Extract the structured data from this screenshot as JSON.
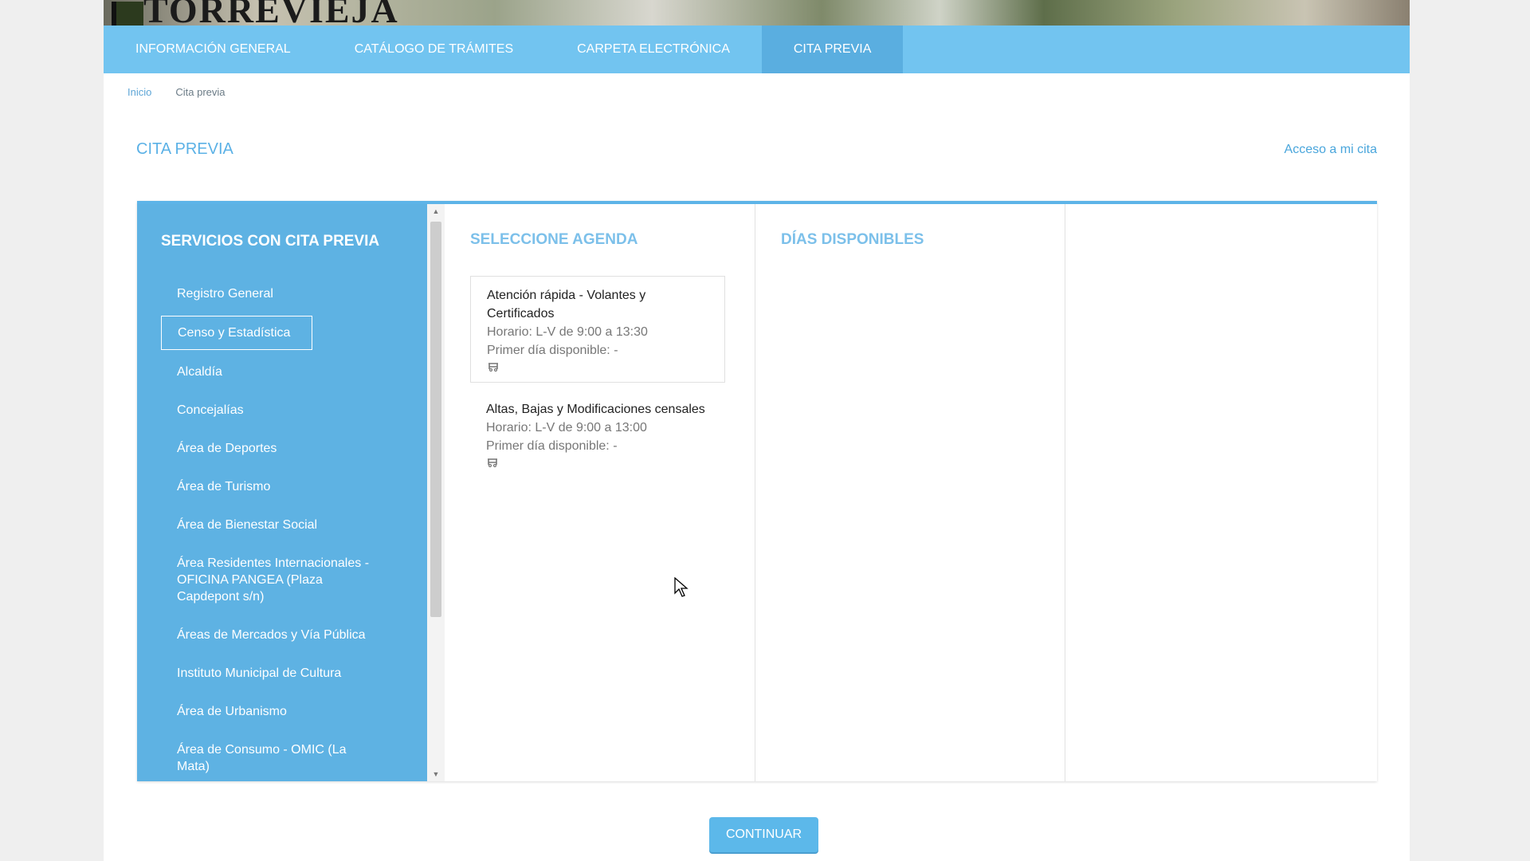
{
  "header": {
    "logo_text": "TORREVIEJA"
  },
  "nav": {
    "items": [
      {
        "label": "Información General"
      },
      {
        "label": "Catálogo de Trámites"
      },
      {
        "label": "Carpeta Electrónica"
      },
      {
        "label": "Cita Previa"
      }
    ],
    "active_index": 3
  },
  "breadcrumb": {
    "home": "Inicio",
    "current": "Cita previa"
  },
  "page": {
    "title": "Cita previa",
    "access_link": "Acceso a mi cita"
  },
  "sidebar": {
    "title": "Servicios con cita previa",
    "selected_index": 1,
    "items": [
      {
        "label": "Registro General"
      },
      {
        "label": "Censo y Estadística"
      },
      {
        "label": "Alcaldía"
      },
      {
        "label": "Concejalías"
      },
      {
        "label": "Área de Deportes"
      },
      {
        "label": "Área de Turismo"
      },
      {
        "label": "Área de Bienestar Social"
      },
      {
        "label": "Área Residentes Internacionales - OFICINA PANGEA (Plaza Capdepont s/n)"
      },
      {
        "label": "Áreas de Mercados y Vía Pública"
      },
      {
        "label": "Instituto Municipal de Cultura"
      },
      {
        "label": "Área de Urbanismo"
      },
      {
        "label": "Área de Consumo - OMIC (La Mata)"
      }
    ]
  },
  "agenda": {
    "title": "Seleccione agenda",
    "items": [
      {
        "name": "Atención rápida - Volantes y Certificados",
        "schedule": "Horario: L-V de 9:00 a 13:30",
        "first_day": "Primer día disponible: -",
        "icon": "wheelchair-icon"
      },
      {
        "name": "Altas, Bajas y Modificaciones censales",
        "schedule": "Horario: L-V de 9:00 a 13:00",
        "first_day": "Primer día disponible: -",
        "icon": "wheelchair-icon"
      }
    ]
  },
  "days": {
    "title": "Días disponibles"
  },
  "actions": {
    "continue_label": "Continuar"
  },
  "colors": {
    "nav_bg": "#72c4f0",
    "nav_active": "#5aaee0",
    "sidebar_bg": "#5eb2e3",
    "accent": "#5bb1e6",
    "button": "#5cb8ea"
  }
}
